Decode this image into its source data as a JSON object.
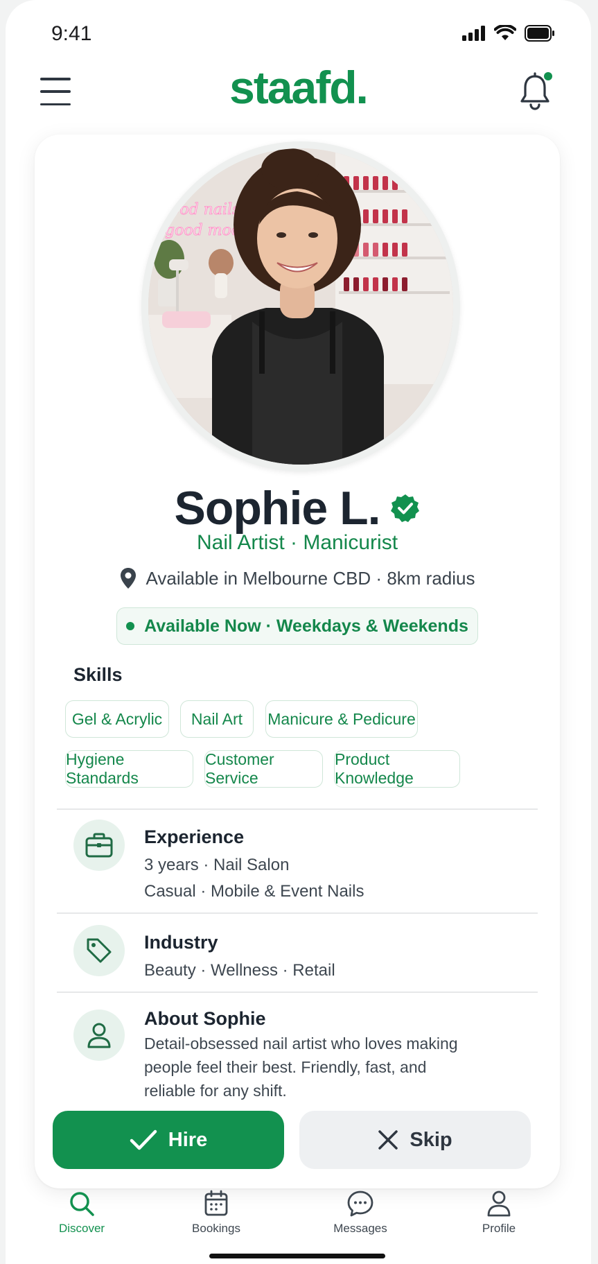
{
  "status_bar": {
    "time": "9:41"
  },
  "header": {
    "logo": "staafd."
  },
  "profile": {
    "photo_sign_text": "good nails good mood",
    "name": "Sophie L.",
    "role": "Nail Artist · Manicurist",
    "location": "Available in Melbourne CBD · 8km radius",
    "availability": "Available Now · Weekdays & Weekends"
  },
  "skills": {
    "title": "Skills",
    "items": [
      "Gel & Acrylic",
      "Nail Art",
      "Manicure & Pedicure",
      "Hygiene Standards",
      "Customer Service",
      "Product Knowledge"
    ]
  },
  "experience": {
    "title": "Experience",
    "line1": "3 years · Nail Salon",
    "line2": "Casual · Mobile & Event Nails"
  },
  "industry": {
    "title": "Industry",
    "line1": "Beauty · Wellness · Retail"
  },
  "about": {
    "title": "About Sophie",
    "line1": "Detail-obsessed nail artist who loves making",
    "line2": "people feel their best. Friendly, fast, and",
    "line3": "reliable for any shift."
  },
  "actions": {
    "hire": "Hire",
    "skip": "Skip"
  },
  "nav": {
    "items": [
      {
        "label": "Discover",
        "icon": "search-icon",
        "active": true
      },
      {
        "label": "Bookings",
        "icon": "calendar-icon",
        "active": false
      },
      {
        "label": "Messages",
        "icon": "chat-bubble-icon",
        "active": false
      },
      {
        "label": "Profile",
        "icon": "person-icon",
        "active": false
      }
    ]
  },
  "colors": {
    "brand": "#12914f",
    "brand_light": "#e7f2ec",
    "text": "#1c2530"
  }
}
